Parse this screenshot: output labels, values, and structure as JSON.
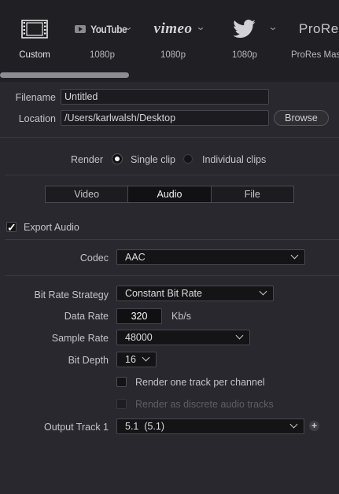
{
  "presets": [
    {
      "name": "Custom",
      "icon": "film-strip-icon",
      "label": "Custom",
      "active": true
    },
    {
      "name": "YouTube",
      "logo_text": "YouTube",
      "label": "1080p"
    },
    {
      "name": "Vimeo",
      "logo_text": "vimeo",
      "label": "1080p"
    },
    {
      "name": "Twitter",
      "icon": "twitter-bird-icon",
      "label": "1080p"
    },
    {
      "name": "ProRes",
      "logo_text": "ProRes",
      "label": "ProRes Mas"
    }
  ],
  "file": {
    "filename_label": "Filename",
    "filename_value": "Untitled",
    "location_label": "Location",
    "location_value": "/Users/karlwalsh/Desktop",
    "browse_label": "Browse"
  },
  "render": {
    "label": "Render",
    "single_clip": "Single clip",
    "individual_clips": "Individual clips",
    "selected": "single_clip"
  },
  "tabs": [
    "Video",
    "Audio",
    "File"
  ],
  "active_tab": "Audio",
  "audio": {
    "export_audio_label": "Export Audio",
    "export_audio_checked": true,
    "codec_label": "Codec",
    "codec_value": "AAC",
    "bit_rate_strategy_label": "Bit Rate Strategy",
    "bit_rate_strategy_value": "Constant Bit Rate",
    "data_rate_label": "Data Rate",
    "data_rate_value": "320",
    "data_rate_unit": "Kb/s",
    "sample_rate_label": "Sample Rate",
    "sample_rate_value": "48000",
    "bit_depth_label": "Bit Depth",
    "bit_depth_value": "16",
    "one_track_label": "Render one track per channel",
    "one_track_checked": false,
    "discrete_label": "Render as discrete audio tracks",
    "discrete_enabled": false,
    "output_track_label": "Output Track 1",
    "output_track_value": "5.1  (5.1)"
  }
}
